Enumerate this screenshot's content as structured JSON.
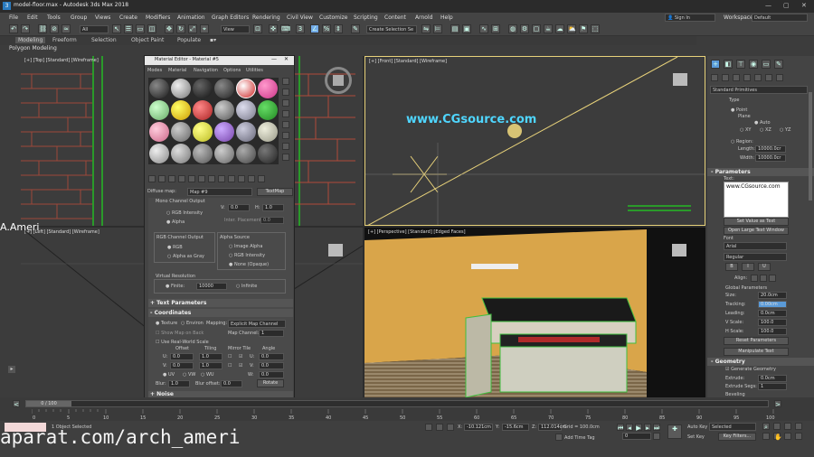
{
  "colors": {
    "bg": "#3c3c3c",
    "selected_border": "#e8d27a",
    "perspective_wall": "#d9a54a",
    "highlight": "#72a9e6",
    "accent_blue": "#5a9ad8"
  },
  "window": {
    "title": "model-floor.max - Autodesk 3ds Max 2018",
    "min": "—",
    "max": "▢",
    "close": "✕"
  },
  "menu": [
    "File",
    "Edit",
    "Tools",
    "Group",
    "Views",
    "Create",
    "Modifiers",
    "Animation",
    "Graph Editors",
    "Rendering",
    "Civil View",
    "Customize",
    "Scripting",
    "Content",
    "Arnold",
    "Help"
  ],
  "account": {
    "sign_in": "Sign In",
    "workspaces_label": "Workspaces:",
    "workspace": "Default"
  },
  "toolbar": {
    "filter": "All",
    "ref": "View",
    "selset": "Create Selection Se"
  },
  "ribbon": {
    "tabs": [
      "Modeling",
      "Freeform",
      "Selection",
      "Object Paint",
      "Populate"
    ],
    "sub": "Polygon Modeling"
  },
  "viewports": {
    "top": "[+] [Top] [Standard] [Wireframe]",
    "front": "[+] [Front] [Standard] [Wireframe]",
    "left": "[+] [Left] [Standard] [Wireframe]",
    "persp": "[+] [Perspective] [Standard] [Edged Faces]",
    "scene_text": "www.CGsource.com",
    "author": "A.Ameri"
  },
  "material_editor": {
    "title": "Material Editor - Material #5",
    "menus": [
      "Modes",
      "Material",
      "Navigation",
      "Options",
      "Utilities"
    ],
    "diffuse_label": "Diffuse map:",
    "map_name": "Map #9",
    "map_type": "TextMap",
    "mono": {
      "title": "Mono Channel Output",
      "opts": [
        "RGB Intensity",
        "Alpha"
      ],
      "v": "V:",
      "v_val": "0.0",
      "h": "H:",
      "h_val": "1.0",
      "inter": "Inter. Placement:",
      "inter_val": "0.0"
    },
    "rgb": {
      "title": "RGB Channel Output",
      "opts": [
        "RGB",
        "Alpha as Gray"
      ]
    },
    "alpha": {
      "title": "Alpha Source",
      "opts": [
        "Image Alpha",
        "RGB Intensity",
        "None (Opaque)"
      ]
    },
    "vres": {
      "title": "Virtual Resolution",
      "finite": "Finite:",
      "finite_val": "10000",
      "infinite": "Infinite"
    },
    "rollouts": {
      "text_params": "Text Parameters",
      "coords": "Coordinates",
      "noise": "Noise"
    },
    "coords": {
      "texture": "Texture",
      "environ": "Environ",
      "mapping": "Mapping:",
      "mapping_val": "Explicit Map Channel",
      "show_back": "Show Map on Back",
      "map_ch": "Map Channel:",
      "map_ch_val": "1",
      "real_world": "Use Real-World Scale",
      "offset": "Offset",
      "tiling": "Tiling",
      "mirror": "Mirror Tile",
      "angle": "Angle",
      "u": "U:",
      "v": "V:",
      "w": "W:",
      "u_off": "0.0",
      "v_off": "0.0",
      "u_til": "1.0",
      "v_til": "1.0",
      "u_ang": "0.0",
      "v_ang": "0.0",
      "w_ang": "0.0",
      "uv": "UV",
      "vw": "VW",
      "wu": "WU",
      "blur": "Blur:",
      "blur_val": "1.0",
      "blur_off": "Blur offset:",
      "blur_off_val": "0.0",
      "rotate": "Rotate"
    }
  },
  "command_panel": {
    "dropdown": "Standard Primitives",
    "type": "Type",
    "point": "Point",
    "plane": "Plane",
    "auto": "Auto",
    "xy": "XY",
    "xz": "XZ",
    "yz": "YZ",
    "region": "Region:",
    "length": "Length:",
    "length_val": "10000.0cr",
    "width": "Width:",
    "width_val": "10000.0cr",
    "params": "Parameters",
    "text_label": "Text:",
    "text_val": "www.CGsource.com",
    "set_value": "Set Value as Text",
    "open_editor": "Open Large Text Window",
    "font_label": "Font",
    "font": "Arial",
    "style": "Regular",
    "b": "B",
    "i": "I",
    "u": "U",
    "align": "Align:",
    "global": "Global Parameters",
    "size": "Size:",
    "size_val": "20.0cm",
    "tracking": "Tracking:",
    "tracking_val": "0.00cm",
    "leading": "Leading:",
    "leading_val": "0.0cm",
    "vscale": "V Scale:",
    "vscale_val": "100.0",
    "hscale": "H Scale:",
    "hscale_val": "100.0",
    "reset": "Reset Parameters",
    "manip": "Manipulate Text",
    "geometry": "Geometry",
    "gen_geo": "Generate Geometry",
    "extrude": "Extrude:",
    "extrude_val": "0.0cm",
    "ext_segs": "Extrude Segs:",
    "ext_segs_val": "1",
    "beveling": "Beveling"
  },
  "timeline": {
    "frame": "0 / 100",
    "ticks": [
      "0",
      "5",
      "10",
      "15",
      "20",
      "25",
      "30",
      "35",
      "40",
      "45",
      "50",
      "55",
      "60",
      "65",
      "70",
      "75",
      "80",
      "85",
      "90",
      "95",
      "100"
    ]
  },
  "status": {
    "selected": "1 Object Selected",
    "x": "X:",
    "x_val": "-10.121cm",
    "y": "Y:",
    "y_val": "-15.6cm",
    "z": "Z:",
    "z_val": "112.014cm",
    "grid": "Grid = 100.0cm",
    "add_tag": "Add Time Tag",
    "autokey": "Auto Key",
    "selected_dd": "Selected",
    "setkey": "Set Key",
    "keyfilters": "Key Filters...",
    "frame_val": "0",
    "maxscript": "MAXScript Mi"
  },
  "watermark": "aparat.com/arch_ameri"
}
